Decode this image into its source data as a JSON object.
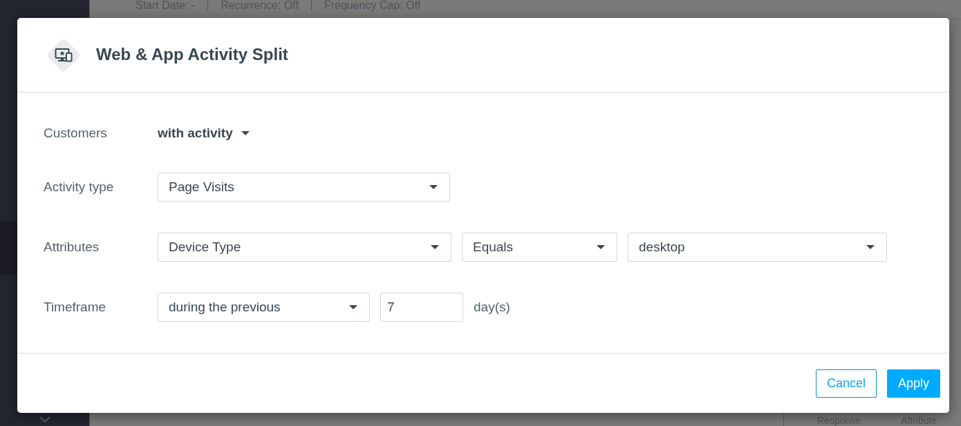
{
  "background": {
    "summary": [
      "Start Date: -",
      "Recurrence: Off",
      "Frequency Cap: Off"
    ],
    "columns": [
      "Response",
      "Attribute"
    ]
  },
  "dialog": {
    "title": "Web & App Activity Split",
    "rows": [
      {
        "label": "Customers",
        "controls": [
          {
            "kind": "menu",
            "value": "with activity"
          }
        ]
      },
      {
        "label": "Activity type",
        "controls": [
          {
            "kind": "select",
            "value": "Page Visits"
          }
        ]
      },
      {
        "label": "Attributes",
        "controls": [
          {
            "kind": "select",
            "value": "Device Type"
          },
          {
            "kind": "select",
            "value": "Equals"
          },
          {
            "kind": "select",
            "value": "desktop"
          }
        ]
      },
      {
        "label": "Timeframe",
        "controls": [
          {
            "kind": "select",
            "value": "during the previous"
          },
          {
            "kind": "input",
            "value": "7"
          },
          {
            "kind": "text",
            "value": "day(s)"
          }
        ]
      }
    ],
    "buttons": [
      {
        "kind": "secondary",
        "label": "Cancel"
      },
      {
        "kind": "primary",
        "label": "Apply"
      }
    ]
  }
}
